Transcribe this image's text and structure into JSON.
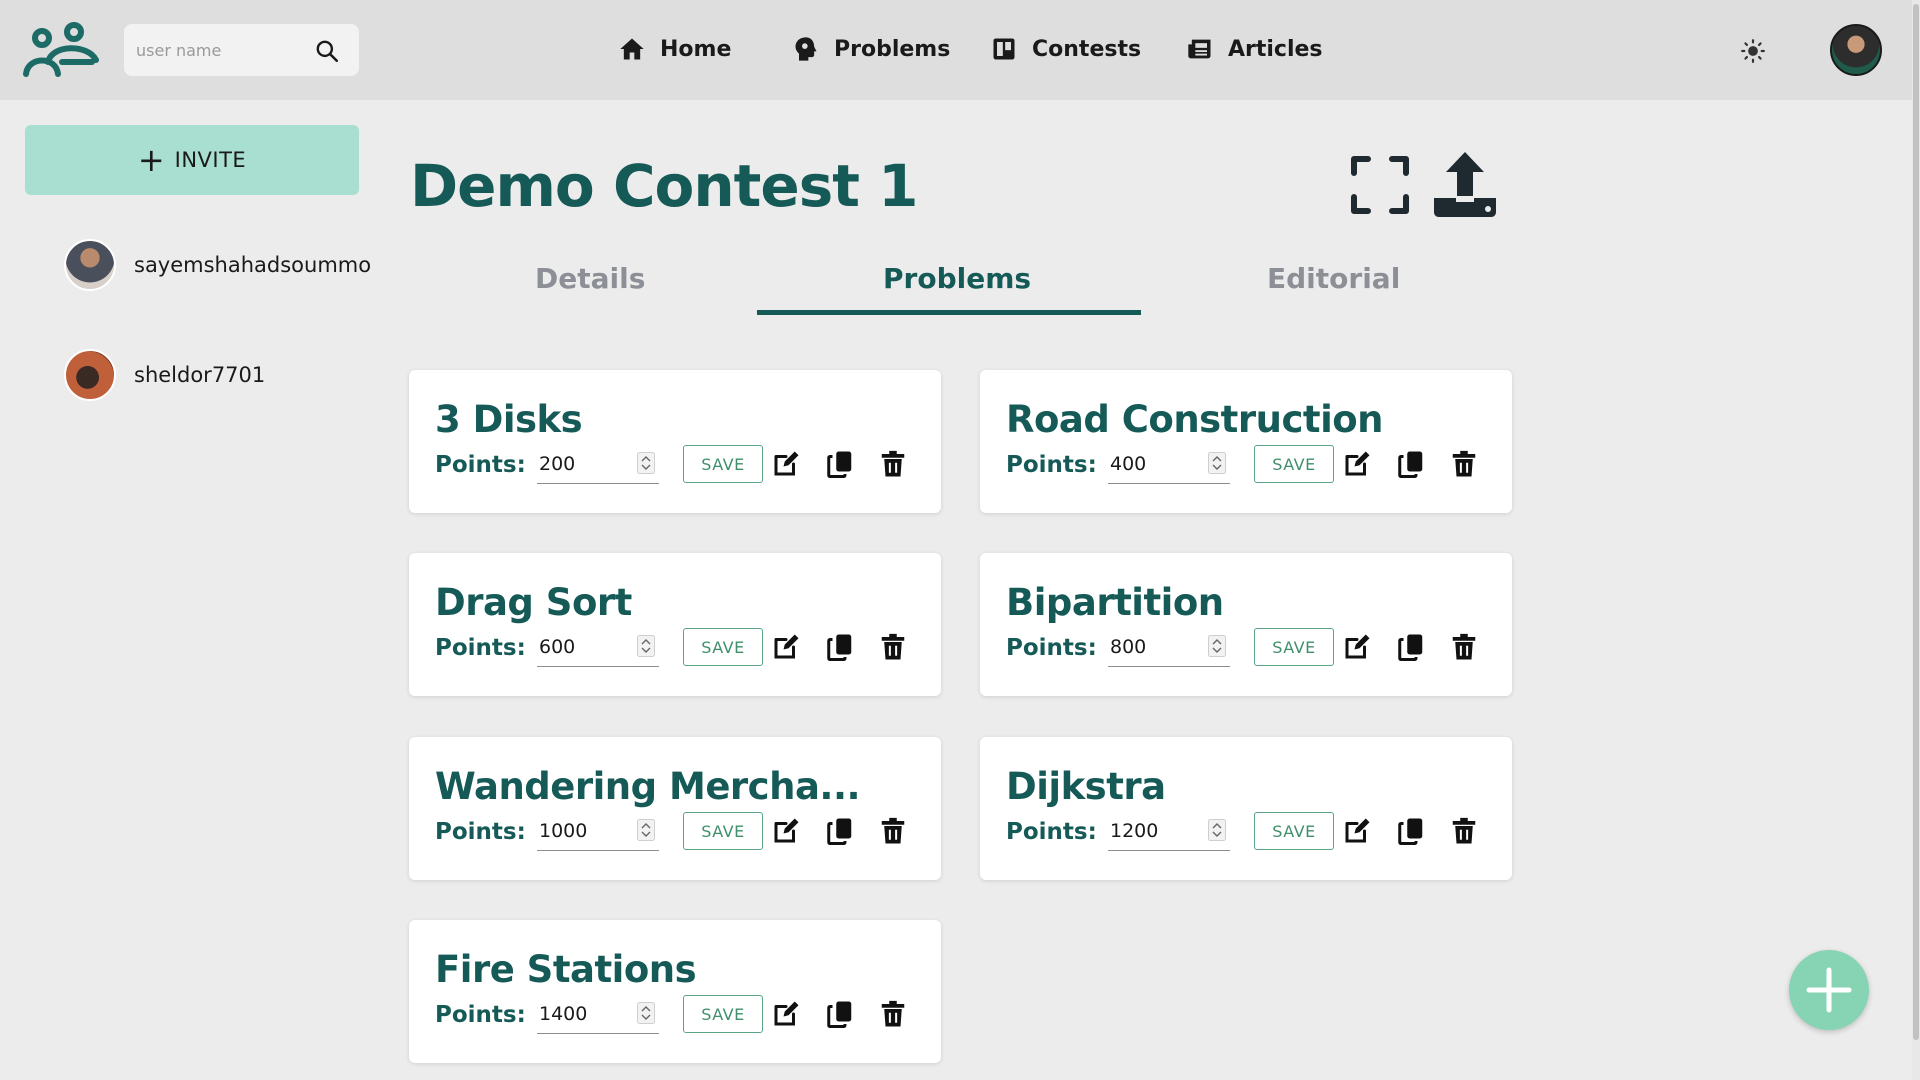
{
  "header": {
    "search": {
      "placeholder": "user name"
    },
    "nav": [
      {
        "label": "Home",
        "icon": "home-icon"
      },
      {
        "label": "Problems",
        "icon": "brain-icon"
      },
      {
        "label": "Contests",
        "icon": "board-icon"
      },
      {
        "label": "Articles",
        "icon": "newspaper-icon"
      }
    ],
    "theme_icon": "sun-icon",
    "avatar": "user-avatar"
  },
  "sidebar": {
    "invite_label": "INVITE",
    "members": [
      {
        "name": "sayemshahadsoummo"
      },
      {
        "name": "sheldor7701"
      }
    ]
  },
  "contest": {
    "title": "Demo Contest 1",
    "tabs": [
      {
        "label": "Details",
        "active": false
      },
      {
        "label": "Problems",
        "active": true
      },
      {
        "label": "Editorial",
        "active": false
      }
    ],
    "points_label": "Points:",
    "save_label": "SAVE",
    "problems": [
      {
        "title": "3 Disks",
        "points": "200"
      },
      {
        "title": "Road Construction",
        "points": "400"
      },
      {
        "title": "Drag Sort",
        "points": "600"
      },
      {
        "title": "Bipartition",
        "points": "800"
      },
      {
        "title": "Wandering Mercha...",
        "points": "1000"
      },
      {
        "title": "Dijkstra",
        "points": "1200"
      },
      {
        "title": "Fire Stations",
        "points": "1400"
      }
    ]
  },
  "colors": {
    "accent": "#155a57",
    "invite_bg": "#a8dfd0",
    "fab_bg": "#86d4b4",
    "save_border": "#5aa584"
  }
}
